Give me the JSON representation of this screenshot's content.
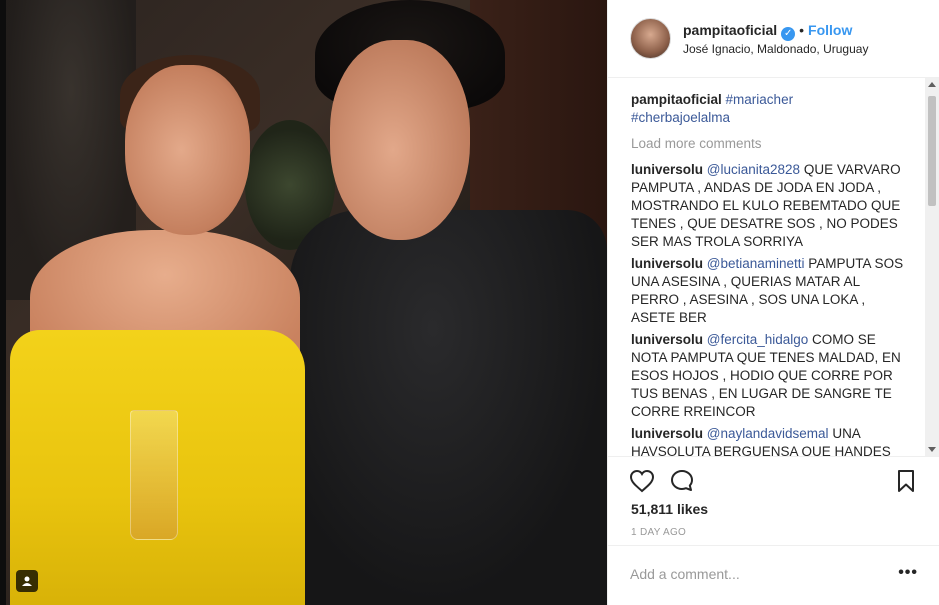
{
  "post": {
    "username": "pampitaoficial",
    "verified_mark": "✓",
    "separator": "•",
    "follow_label": "Follow",
    "location": "José Ignacio, Maldonado, Uruguay",
    "caption_user": "pampitaoficial",
    "caption_tag_1": "#mariacher",
    "caption_tag_2": "#cherbajoelalma",
    "load_more": "Load more comments",
    "likes": "51,811 likes",
    "time": "1 DAY AGO",
    "add_comment_placeholder": "Add a comment...",
    "more_options": "•••"
  },
  "comments": [
    {
      "user": "luniversolu",
      "mention": "@lucianita2828",
      "text": " QUE VARVARO PAMPUTA , ANDAS DE JODA EN JODA , MOSTRANDO EL KULO REBEMTADO QUE TENES , QUE DESATRE SOS , NO PODES SER MAS TROLA SORRIYA"
    },
    {
      "user": "luniversolu",
      "mention": "@betianaminetti",
      "text": " PAMPUTA SOS UNA ASESINA , QUERIAS MATAR AL PERRO , ASESINA , SOS UNA LOKA , ASETE BER"
    },
    {
      "user": "luniversolu",
      "mention": "@fercita_hidalgo",
      "text": " COMO SE NOTA PAMPUTA QUE TENES MALDAD, EN ESOS HOJOS , HODIO QUE CORRE POR TUS BENAS , EN LUGAR DE SANGRE TE CORRE RREINCOR"
    },
    {
      "user": "luniversolu",
      "mention": "@naylandavidsemal",
      "text": " UNA HAVSOLUTA BERGUENSA QUE HANDES"
    }
  ],
  "icons": {
    "like": "heart-outline",
    "comment": "speech-bubble",
    "save": "bookmark",
    "user_tag": "person"
  },
  "colors": {
    "accent": "#3897f0",
    "text": "#262626",
    "muted": "#999999",
    "mention": "#3b5998",
    "dress": "#f3d21a"
  }
}
